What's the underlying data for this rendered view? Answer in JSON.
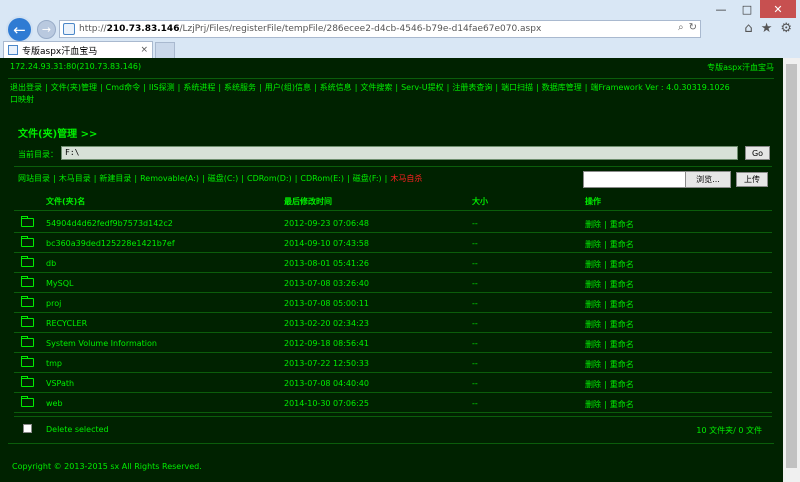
{
  "browser": {
    "url_prefix": "http://",
    "url_host": "210.73.83.146",
    "url_path": "/LzjPrj/Files/registerFile/tempFile/286ecee2-d4cb-4546-b79e-d14fae67e070.aspx",
    "tab_title": "专版aspx汗血宝马",
    "tab_close": "×",
    "win_minimize": "—",
    "win_maximize": "□",
    "win_close": "✕"
  },
  "header": {
    "ip": "172.24.93.31:80(210.73.83.146)",
    "brand": "专版aspx汗血宝马"
  },
  "menu": [
    "退出登录",
    "文件(夹)管理",
    "Cmd命令",
    "IIS探测",
    "系统进程",
    "系统服务",
    "用户(组)信息",
    "系统信息",
    "文件搜索",
    "Serv-U提权",
    "注册表查询",
    "端口扫描",
    "数据库管理",
    "端Framework Ver : 4.0.30319.1026"
  ],
  "menu_tail": "口映射",
  "section": {
    "title": "文件(夹)管理 >>",
    "curdir_label": "当前目录：",
    "curdir_value": "F:\\",
    "go_label": "Go"
  },
  "drives": {
    "items": [
      "网站目录",
      "木马目录",
      "新建目录",
      "Removable(A:)",
      "磁盘(C:)",
      "CDRom(D:)",
      "CDRom(E:)",
      "磁盘(F:)"
    ],
    "highlight": "木马自杀"
  },
  "upload": {
    "browse_label": "浏览...",
    "upload_label": "上传"
  },
  "table": {
    "headers": {
      "name": "文件(夹)名",
      "time": "最后修改时间",
      "size": "大小",
      "ops": "操作"
    },
    "rows": [
      {
        "name": "54904d4d62fedf9b7573d142c2",
        "time": "2012-09-23 07:06:48",
        "size": "--"
      },
      {
        "name": "bc360a39ded125228e1421b7ef",
        "time": "2014-09-10 07:43:58",
        "size": "--"
      },
      {
        "name": "db",
        "time": "2013-08-01 05:41:26",
        "size": "--"
      },
      {
        "name": "MySQL",
        "time": "2013-07-08 03:26:40",
        "size": "--"
      },
      {
        "name": "proj",
        "time": "2013-07-08 05:00:11",
        "size": "--"
      },
      {
        "name": "RECYCLER",
        "time": "2013-02-20 02:34:23",
        "size": "--"
      },
      {
        "name": "System Volume Information",
        "time": "2012-09-18 08:56:41",
        "size": "--"
      },
      {
        "name": "tmp",
        "time": "2013-07-22 12:50:33",
        "size": "--"
      },
      {
        "name": "VSPath",
        "time": "2013-07-08 04:40:40",
        "size": "--"
      },
      {
        "name": "web",
        "time": "2014-10-30 07:06:25",
        "size": "--"
      }
    ],
    "op_delete": "删除",
    "op_sep": "|",
    "op_rename": "重命名"
  },
  "footer": {
    "delete_selected": "Delete selected",
    "count": "10 文件夹/ 0 文件",
    "copyright": "Copyright © 2013-2015 sx All Rights Reserved."
  },
  "colors": {
    "page_bg": "#002200",
    "text": "#00ee00",
    "highlight": "#ff2020"
  }
}
